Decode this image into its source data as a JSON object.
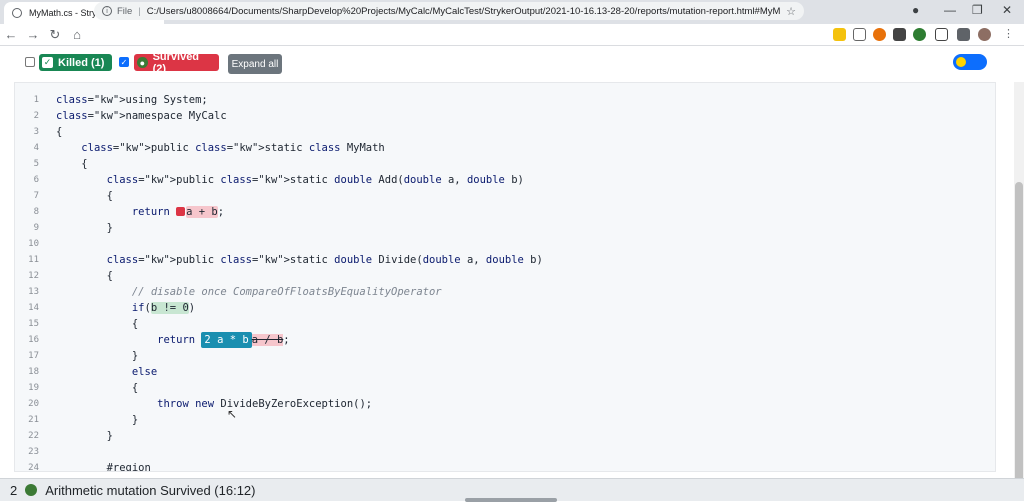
{
  "browser": {
    "tab_title": "MyMath.cs - Stryker.NET Report",
    "file_label": "File",
    "url": "C:/Users/u8008664/Documents/SharpDevelop%20Projects/MyCalc/MyCalcTest/StrykerOutput/2021-10-16.13-28-20/reports/mutation-report.html#MyM..."
  },
  "toolbar": {
    "killed_label": "Killed (1)",
    "survived_label": "Survived (2)",
    "expand_label": "Expand all",
    "killed_checked": false,
    "survived_checked": true
  },
  "code_lines": [
    {
      "n": "1",
      "t": "using System;"
    },
    {
      "n": "2",
      "t": "namespace MyCalc"
    },
    {
      "n": "3",
      "t": "{"
    },
    {
      "n": "4",
      "t": "    public static class MyMath"
    },
    {
      "n": "5",
      "t": "    {"
    },
    {
      "n": "6",
      "t": "        public static double Add(double a, double b)"
    },
    {
      "n": "7",
      "t": "        {"
    },
    {
      "n": "8",
      "t": "            return a + b;"
    },
    {
      "n": "9",
      "t": "        }"
    },
    {
      "n": "10",
      "t": ""
    },
    {
      "n": "11",
      "t": "        public static double Divide(double a, double b)"
    },
    {
      "n": "12",
      "t": "        {"
    },
    {
      "n": "13",
      "t": "            // disable once CompareOfFloatsByEqualityOperator"
    },
    {
      "n": "14",
      "t": "            if(b != 0)"
    },
    {
      "n": "15",
      "t": "            {"
    },
    {
      "n": "16",
      "t": "                return a * b a / b;"
    },
    {
      "n": "17",
      "t": "            }"
    },
    {
      "n": "18",
      "t": "            else"
    },
    {
      "n": "19",
      "t": "            {"
    },
    {
      "n": "20",
      "t": "                throw new DivideByZeroException();"
    },
    {
      "n": "21",
      "t": "            }"
    },
    {
      "n": "22",
      "t": "        }"
    },
    {
      "n": "23",
      "t": ""
    },
    {
      "n": "24",
      "t": "        #region"
    }
  ],
  "mutant_pill": "2",
  "footer": {
    "number": "2",
    "text": "Arithmetic mutation Survived (16:12)"
  },
  "colors": {
    "killed": "#198754",
    "survived": "#dc3545",
    "expand": "#6c757d",
    "mutant_pill": "#1a8fb0"
  }
}
